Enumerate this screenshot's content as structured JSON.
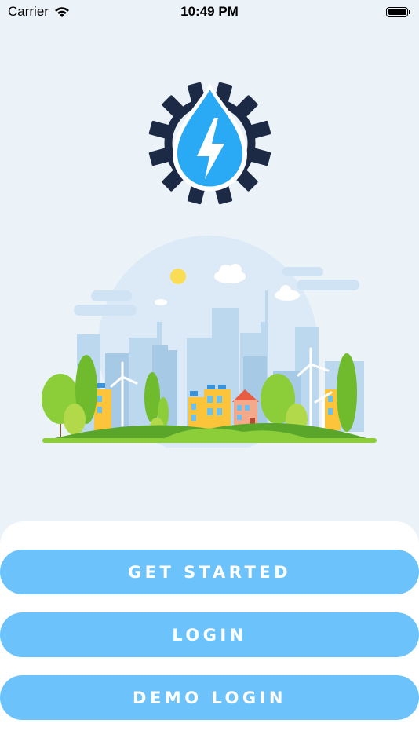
{
  "status_bar": {
    "carrier": "Carrier",
    "time": "10:49 PM",
    "battery_level": 1.0
  },
  "icons": {
    "wifi": "wifi-icon",
    "battery": "battery-icon",
    "logo": "gear-water-drop-lightning-logo",
    "illustration": "green-city-illustration"
  },
  "colors": {
    "background": "#ebf2f8",
    "button": "#6cc3fc",
    "button_text": "#ffffff",
    "logo_gear": "#1c2a45",
    "logo_drop": "#2aa9f4"
  },
  "buttons": {
    "get_started": "GET STARTED",
    "login": "LOGIN",
    "demo_login": "DEMO LOGIN"
  }
}
